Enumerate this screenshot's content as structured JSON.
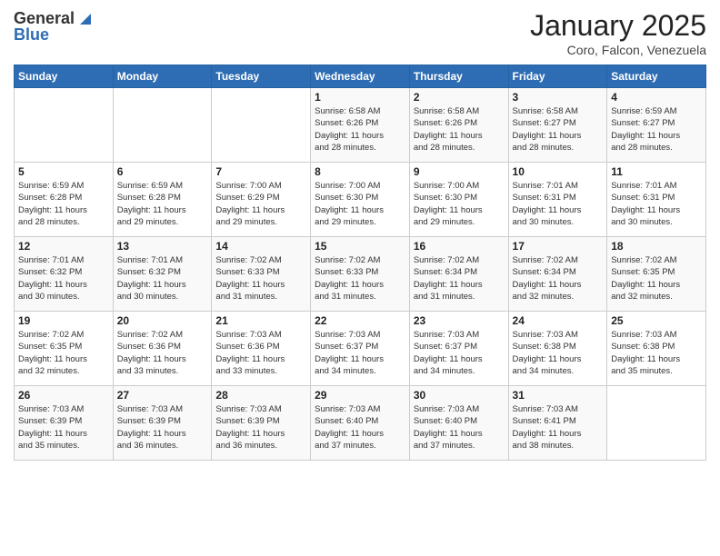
{
  "header": {
    "logo_general": "General",
    "logo_blue": "Blue",
    "month_title": "January 2025",
    "subtitle": "Coro, Falcon, Venezuela"
  },
  "days_of_week": [
    "Sunday",
    "Monday",
    "Tuesday",
    "Wednesday",
    "Thursday",
    "Friday",
    "Saturday"
  ],
  "weeks": [
    [
      {
        "day": "",
        "info": ""
      },
      {
        "day": "",
        "info": ""
      },
      {
        "day": "",
        "info": ""
      },
      {
        "day": "1",
        "info": "Sunrise: 6:58 AM\nSunset: 6:26 PM\nDaylight: 11 hours\nand 28 minutes."
      },
      {
        "day": "2",
        "info": "Sunrise: 6:58 AM\nSunset: 6:26 PM\nDaylight: 11 hours\nand 28 minutes."
      },
      {
        "day": "3",
        "info": "Sunrise: 6:58 AM\nSunset: 6:27 PM\nDaylight: 11 hours\nand 28 minutes."
      },
      {
        "day": "4",
        "info": "Sunrise: 6:59 AM\nSunset: 6:27 PM\nDaylight: 11 hours\nand 28 minutes."
      }
    ],
    [
      {
        "day": "5",
        "info": "Sunrise: 6:59 AM\nSunset: 6:28 PM\nDaylight: 11 hours\nand 28 minutes."
      },
      {
        "day": "6",
        "info": "Sunrise: 6:59 AM\nSunset: 6:28 PM\nDaylight: 11 hours\nand 29 minutes."
      },
      {
        "day": "7",
        "info": "Sunrise: 7:00 AM\nSunset: 6:29 PM\nDaylight: 11 hours\nand 29 minutes."
      },
      {
        "day": "8",
        "info": "Sunrise: 7:00 AM\nSunset: 6:30 PM\nDaylight: 11 hours\nand 29 minutes."
      },
      {
        "day": "9",
        "info": "Sunrise: 7:00 AM\nSunset: 6:30 PM\nDaylight: 11 hours\nand 29 minutes."
      },
      {
        "day": "10",
        "info": "Sunrise: 7:01 AM\nSunset: 6:31 PM\nDaylight: 11 hours\nand 30 minutes."
      },
      {
        "day": "11",
        "info": "Sunrise: 7:01 AM\nSunset: 6:31 PM\nDaylight: 11 hours\nand 30 minutes."
      }
    ],
    [
      {
        "day": "12",
        "info": "Sunrise: 7:01 AM\nSunset: 6:32 PM\nDaylight: 11 hours\nand 30 minutes."
      },
      {
        "day": "13",
        "info": "Sunrise: 7:01 AM\nSunset: 6:32 PM\nDaylight: 11 hours\nand 30 minutes."
      },
      {
        "day": "14",
        "info": "Sunrise: 7:02 AM\nSunset: 6:33 PM\nDaylight: 11 hours\nand 31 minutes."
      },
      {
        "day": "15",
        "info": "Sunrise: 7:02 AM\nSunset: 6:33 PM\nDaylight: 11 hours\nand 31 minutes."
      },
      {
        "day": "16",
        "info": "Sunrise: 7:02 AM\nSunset: 6:34 PM\nDaylight: 11 hours\nand 31 minutes."
      },
      {
        "day": "17",
        "info": "Sunrise: 7:02 AM\nSunset: 6:34 PM\nDaylight: 11 hours\nand 32 minutes."
      },
      {
        "day": "18",
        "info": "Sunrise: 7:02 AM\nSunset: 6:35 PM\nDaylight: 11 hours\nand 32 minutes."
      }
    ],
    [
      {
        "day": "19",
        "info": "Sunrise: 7:02 AM\nSunset: 6:35 PM\nDaylight: 11 hours\nand 32 minutes."
      },
      {
        "day": "20",
        "info": "Sunrise: 7:02 AM\nSunset: 6:36 PM\nDaylight: 11 hours\nand 33 minutes."
      },
      {
        "day": "21",
        "info": "Sunrise: 7:03 AM\nSunset: 6:36 PM\nDaylight: 11 hours\nand 33 minutes."
      },
      {
        "day": "22",
        "info": "Sunrise: 7:03 AM\nSunset: 6:37 PM\nDaylight: 11 hours\nand 34 minutes."
      },
      {
        "day": "23",
        "info": "Sunrise: 7:03 AM\nSunset: 6:37 PM\nDaylight: 11 hours\nand 34 minutes."
      },
      {
        "day": "24",
        "info": "Sunrise: 7:03 AM\nSunset: 6:38 PM\nDaylight: 11 hours\nand 34 minutes."
      },
      {
        "day": "25",
        "info": "Sunrise: 7:03 AM\nSunset: 6:38 PM\nDaylight: 11 hours\nand 35 minutes."
      }
    ],
    [
      {
        "day": "26",
        "info": "Sunrise: 7:03 AM\nSunset: 6:39 PM\nDaylight: 11 hours\nand 35 minutes."
      },
      {
        "day": "27",
        "info": "Sunrise: 7:03 AM\nSunset: 6:39 PM\nDaylight: 11 hours\nand 36 minutes."
      },
      {
        "day": "28",
        "info": "Sunrise: 7:03 AM\nSunset: 6:39 PM\nDaylight: 11 hours\nand 36 minutes."
      },
      {
        "day": "29",
        "info": "Sunrise: 7:03 AM\nSunset: 6:40 PM\nDaylight: 11 hours\nand 37 minutes."
      },
      {
        "day": "30",
        "info": "Sunrise: 7:03 AM\nSunset: 6:40 PM\nDaylight: 11 hours\nand 37 minutes."
      },
      {
        "day": "31",
        "info": "Sunrise: 7:03 AM\nSunset: 6:41 PM\nDaylight: 11 hours\nand 38 minutes."
      },
      {
        "day": "",
        "info": ""
      }
    ]
  ]
}
